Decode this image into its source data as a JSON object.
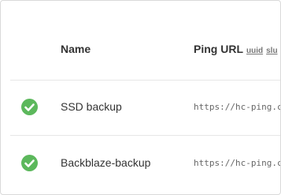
{
  "table": {
    "headers": {
      "name": "Name",
      "ping_url": "Ping URL",
      "format_links": [
        "uuid",
        "slu"
      ]
    },
    "rows": [
      {
        "status": "up",
        "status_icon": "check-circle-icon",
        "name": "SSD backup",
        "ping_url": "https://hc-ping.c"
      },
      {
        "status": "up",
        "status_icon": "check-circle-icon",
        "name": "Backblaze-backup",
        "ping_url": "https://hc-ping.c"
      }
    ]
  },
  "colors": {
    "status_up": "#5cb85c",
    "header_text": "#333333",
    "url_text": "#666666",
    "divider": "#e6e6e6"
  }
}
